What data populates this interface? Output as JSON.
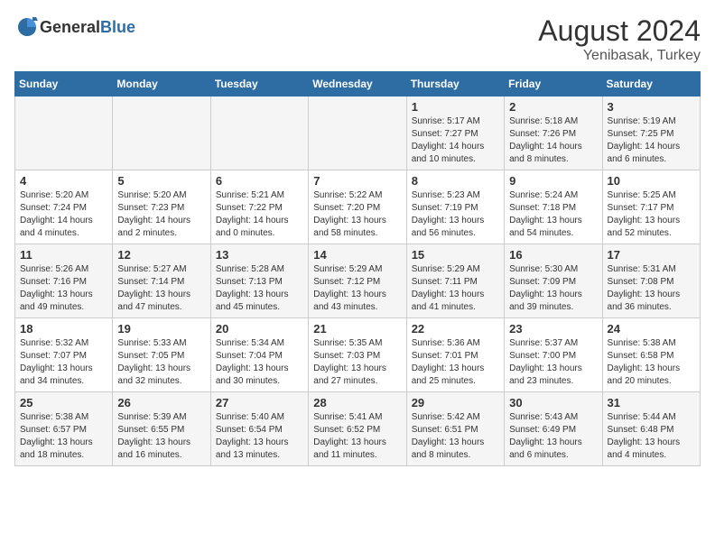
{
  "logo": {
    "general": "General",
    "blue": "Blue"
  },
  "title": "August 2024",
  "subtitle": "Yenibasak, Turkey",
  "days": [
    "Sunday",
    "Monday",
    "Tuesday",
    "Wednesday",
    "Thursday",
    "Friday",
    "Saturday"
  ],
  "weeks": [
    [
      {
        "date": "",
        "info": ""
      },
      {
        "date": "",
        "info": ""
      },
      {
        "date": "",
        "info": ""
      },
      {
        "date": "",
        "info": ""
      },
      {
        "date": "1",
        "info": "Sunrise: 5:17 AM\nSunset: 7:27 PM\nDaylight: 14 hours and 10 minutes."
      },
      {
        "date": "2",
        "info": "Sunrise: 5:18 AM\nSunset: 7:26 PM\nDaylight: 14 hours and 8 minutes."
      },
      {
        "date": "3",
        "info": "Sunrise: 5:19 AM\nSunset: 7:25 PM\nDaylight: 14 hours and 6 minutes."
      }
    ],
    [
      {
        "date": "4",
        "info": "Sunrise: 5:20 AM\nSunset: 7:24 PM\nDaylight: 14 hours and 4 minutes."
      },
      {
        "date": "5",
        "info": "Sunrise: 5:20 AM\nSunset: 7:23 PM\nDaylight: 14 hours and 2 minutes."
      },
      {
        "date": "6",
        "info": "Sunrise: 5:21 AM\nSunset: 7:22 PM\nDaylight: 14 hours and 0 minutes."
      },
      {
        "date": "7",
        "info": "Sunrise: 5:22 AM\nSunset: 7:20 PM\nDaylight: 13 hours and 58 minutes."
      },
      {
        "date": "8",
        "info": "Sunrise: 5:23 AM\nSunset: 7:19 PM\nDaylight: 13 hours and 56 minutes."
      },
      {
        "date": "9",
        "info": "Sunrise: 5:24 AM\nSunset: 7:18 PM\nDaylight: 13 hours and 54 minutes."
      },
      {
        "date": "10",
        "info": "Sunrise: 5:25 AM\nSunset: 7:17 PM\nDaylight: 13 hours and 52 minutes."
      }
    ],
    [
      {
        "date": "11",
        "info": "Sunrise: 5:26 AM\nSunset: 7:16 PM\nDaylight: 13 hours and 49 minutes."
      },
      {
        "date": "12",
        "info": "Sunrise: 5:27 AM\nSunset: 7:14 PM\nDaylight: 13 hours and 47 minutes."
      },
      {
        "date": "13",
        "info": "Sunrise: 5:28 AM\nSunset: 7:13 PM\nDaylight: 13 hours and 45 minutes."
      },
      {
        "date": "14",
        "info": "Sunrise: 5:29 AM\nSunset: 7:12 PM\nDaylight: 13 hours and 43 minutes."
      },
      {
        "date": "15",
        "info": "Sunrise: 5:29 AM\nSunset: 7:11 PM\nDaylight: 13 hours and 41 minutes."
      },
      {
        "date": "16",
        "info": "Sunrise: 5:30 AM\nSunset: 7:09 PM\nDaylight: 13 hours and 39 minutes."
      },
      {
        "date": "17",
        "info": "Sunrise: 5:31 AM\nSunset: 7:08 PM\nDaylight: 13 hours and 36 minutes."
      }
    ],
    [
      {
        "date": "18",
        "info": "Sunrise: 5:32 AM\nSunset: 7:07 PM\nDaylight: 13 hours and 34 minutes."
      },
      {
        "date": "19",
        "info": "Sunrise: 5:33 AM\nSunset: 7:05 PM\nDaylight: 13 hours and 32 minutes."
      },
      {
        "date": "20",
        "info": "Sunrise: 5:34 AM\nSunset: 7:04 PM\nDaylight: 13 hours and 30 minutes."
      },
      {
        "date": "21",
        "info": "Sunrise: 5:35 AM\nSunset: 7:03 PM\nDaylight: 13 hours and 27 minutes."
      },
      {
        "date": "22",
        "info": "Sunrise: 5:36 AM\nSunset: 7:01 PM\nDaylight: 13 hours and 25 minutes."
      },
      {
        "date": "23",
        "info": "Sunrise: 5:37 AM\nSunset: 7:00 PM\nDaylight: 13 hours and 23 minutes."
      },
      {
        "date": "24",
        "info": "Sunrise: 5:38 AM\nSunset: 6:58 PM\nDaylight: 13 hours and 20 minutes."
      }
    ],
    [
      {
        "date": "25",
        "info": "Sunrise: 5:38 AM\nSunset: 6:57 PM\nDaylight: 13 hours and 18 minutes."
      },
      {
        "date": "26",
        "info": "Sunrise: 5:39 AM\nSunset: 6:55 PM\nDaylight: 13 hours and 16 minutes."
      },
      {
        "date": "27",
        "info": "Sunrise: 5:40 AM\nSunset: 6:54 PM\nDaylight: 13 hours and 13 minutes."
      },
      {
        "date": "28",
        "info": "Sunrise: 5:41 AM\nSunset: 6:52 PM\nDaylight: 13 hours and 11 minutes."
      },
      {
        "date": "29",
        "info": "Sunrise: 5:42 AM\nSunset: 6:51 PM\nDaylight: 13 hours and 8 minutes."
      },
      {
        "date": "30",
        "info": "Sunrise: 5:43 AM\nSunset: 6:49 PM\nDaylight: 13 hours and 6 minutes."
      },
      {
        "date": "31",
        "info": "Sunrise: 5:44 AM\nSunset: 6:48 PM\nDaylight: 13 hours and 4 minutes."
      }
    ]
  ]
}
